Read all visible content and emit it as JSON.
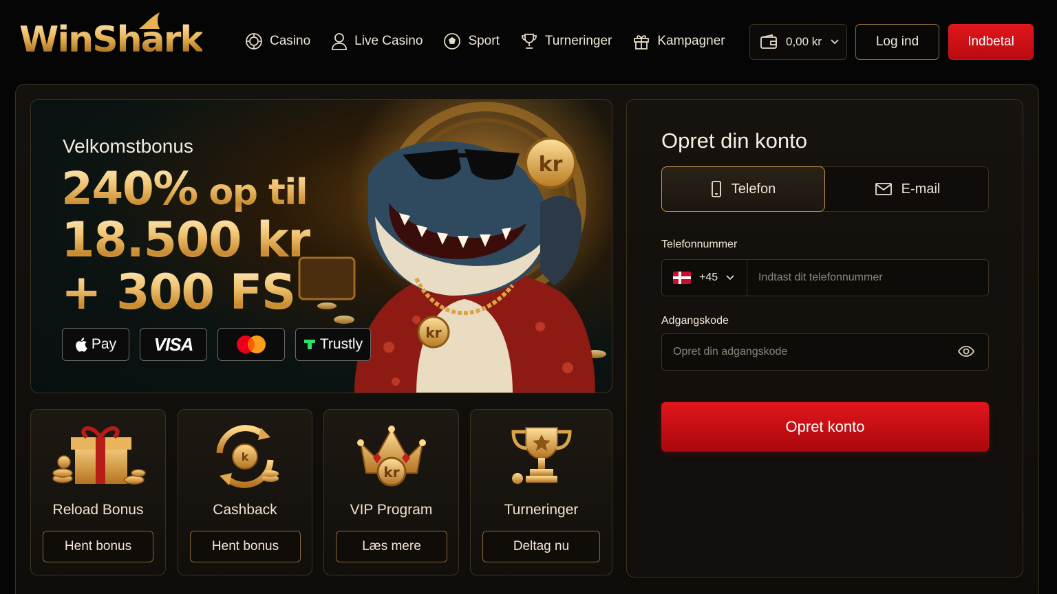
{
  "brand": {
    "name": "WinShark"
  },
  "nav": [
    {
      "label": "Casino",
      "icon": "casino-chip-icon"
    },
    {
      "label": "Live Casino",
      "icon": "user-icon"
    },
    {
      "label": "Sport",
      "icon": "soccer-ball-icon"
    },
    {
      "label": "Turneringer",
      "icon": "trophy-icon"
    },
    {
      "label": "Kampagner",
      "icon": "gift-icon"
    }
  ],
  "header": {
    "balance": "0,00 kr",
    "login_label": "Log ind",
    "deposit_label": "Indbetal"
  },
  "hero": {
    "subtitle": "Velkomstbonus",
    "line1_big": "240%",
    "line1_small": " op til",
    "line2": "18.500 kr",
    "line3": "+ 300 FS",
    "payments": [
      "Pay",
      "VISA",
      "Mastercard",
      "Trustly"
    ]
  },
  "cards": [
    {
      "title": "Reload Bonus",
      "button": "Hent bonus"
    },
    {
      "title": "Cashback",
      "button": "Hent bonus"
    },
    {
      "title": "VIP Program",
      "button": "Læs mere"
    },
    {
      "title": "Turneringer",
      "button": "Deltag nu"
    }
  ],
  "signup": {
    "title": "Opret din konto",
    "tab_phone": "Telefon",
    "tab_email": "E-mail",
    "phone_label": "Telefonnummer",
    "country_code": "+45",
    "phone_placeholder": "Indtast dit telefonnummer",
    "password_label": "Adgangskode",
    "password_placeholder": "Opret din adgangskode",
    "submit_label": "Opret konto"
  },
  "colors": {
    "gold": "#e9b457",
    "red": "#d81218",
    "background": "#050505"
  }
}
